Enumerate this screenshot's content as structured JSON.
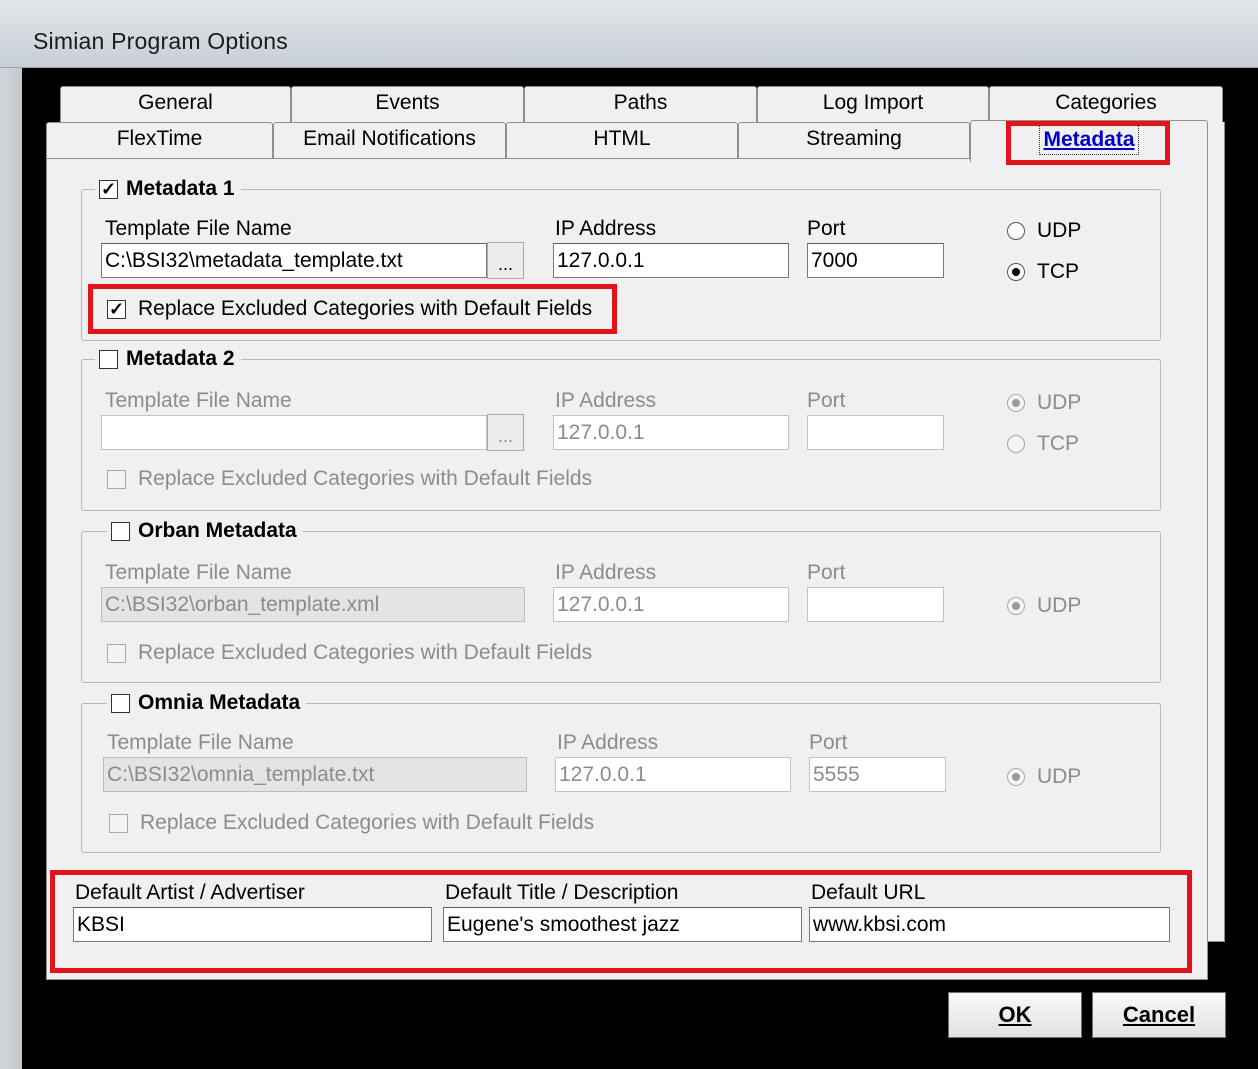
{
  "window": {
    "title": "Simian Program Options"
  },
  "tabs": {
    "row1": [
      "General",
      "Events",
      "Paths",
      "Log Import",
      "Categories"
    ],
    "row2": [
      "FlexTime",
      "Email Notifications",
      "HTML",
      "Streaming"
    ],
    "active": "Metadata"
  },
  "labels": {
    "template_file_name": "Template File Name",
    "ip_address": "IP Address",
    "port": "Port",
    "udp": "UDP",
    "tcp": "TCP",
    "replace": "Replace Excluded Categories with Default Fields",
    "browse": "..."
  },
  "metadata1": {
    "title": "Metadata 1",
    "enabled": true,
    "template": "C:\\BSI32\\metadata_template.txt",
    "ip": "127.0.0.1",
    "port": "7000",
    "protocol": "TCP",
    "replace_checked": true
  },
  "metadata2": {
    "title": "Metadata 2",
    "enabled": false,
    "template": "",
    "ip": "127.0.0.1",
    "port": "",
    "protocol": "UDP",
    "replace_checked": false
  },
  "orban": {
    "title": "Orban Metadata",
    "enabled": false,
    "template": "C:\\BSI32\\orban_template.xml",
    "ip": "127.0.0.1",
    "port": "",
    "protocol": "UDP",
    "replace_checked": false
  },
  "omnia": {
    "title": "Omnia Metadata",
    "enabled": false,
    "template": "C:\\BSI32\\omnia_template.txt",
    "ip": "127.0.0.1",
    "port": "5555",
    "protocol": "UDP",
    "replace_checked": false
  },
  "defaults": {
    "artist_label": "Default Artist / Advertiser",
    "artist_value": "KBSI",
    "title_label": "Default Title / Description",
    "title_value": "Eugene's smoothest jazz",
    "url_label": "Default URL",
    "url_value": "www.kbsi.com"
  },
  "buttons": {
    "ok": "OK",
    "cancel": "Cancel"
  },
  "colors": {
    "highlight": "#e1141c",
    "active_tab_text": "#0000c8"
  }
}
